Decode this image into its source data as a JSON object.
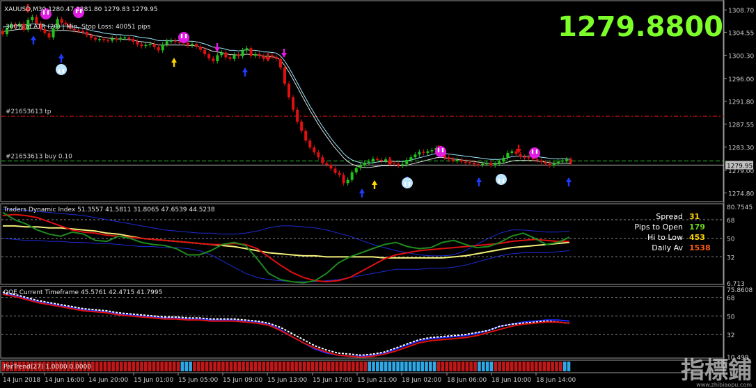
{
  "main": {
    "symbol_line": "XAUUSD,M30  1280.47 1281.80 1279.83 1279.95",
    "info_line": "300% of ATR (20) | Min. Stop Loss:  40051 pips",
    "big_price": "1279.8800",
    "tp_label": "#21653613 tp",
    "buy_label": "#21653613 buy 0.10",
    "current_price_label": "1279.95",
    "price_ticks": [
      "1308.70",
      "1304.55",
      "1300.30",
      "1296.00",
      "1291.80",
      "1287.55",
      "1283.30",
      "1279.00",
      "1274.80"
    ],
    "price_range": [
      1273.3,
      1310.4
    ]
  },
  "tdi": {
    "label": "Traders Dynamic Index 51.3557 41.5811 31.8065 47.6539 44.5238",
    "ticks": [
      "80.7545",
      "68",
      "50",
      "32",
      "6.713"
    ],
    "stats": [
      {
        "label": "Spread",
        "value": "31",
        "color": "#ffd400"
      },
      {
        "label": "Pips to Open",
        "value": "179",
        "color": "#6cd81c"
      },
      {
        "label": "Hi to Low",
        "value": "453",
        "color": "#ffd400"
      },
      {
        "label": "Daily Av",
        "value": "1538",
        "color": "#ff5b1a"
      }
    ]
  },
  "qqe": {
    "label": "QQE Current Timeframe 45.5761 42.4715 41.7995",
    "ticks": [
      "75.8608",
      "68",
      "50",
      "32",
      "10.499"
    ]
  },
  "strip": {
    "label": "ParTrend(27) 1.0000 0.0000"
  },
  "time_labels": [
    "14 Jun 2018",
    "14 Jun 16:00",
    "14 Jun 20:00",
    "15 Jun 01:00",
    "15 Jun 05:00",
    "15 Jun 09:00",
    "15 Jun 13:00",
    "15 Jun 17:00",
    "15 Jun 21:00",
    "18 Jun 02:00",
    "18 Jun 06:00",
    "18 Jun 10:00",
    "18 Jun 14:00"
  ],
  "watermark": {
    "cn": "指標鋪",
    "url": "www.zhibiaopu.com"
  },
  "colors": {
    "bull": "#22c31a",
    "bear": "#e01010",
    "accent": "#7dff2a",
    "up_arrow": "#1f3bff",
    "magenta": "#e11de1",
    "cyan": "#bfe6ff",
    "yellow": "#f4f07a"
  },
  "chart_data": [
    {
      "type": "candlestick",
      "title": "XAUUSD,M30",
      "ylim": [
        1273.3,
        1310.4
      ],
      "close": [
        1304.2,
        1305.4,
        1306.0,
        1305.6,
        1306.1,
        1305.0,
        1306.8,
        1307.4,
        1306.2,
        1305.1,
        1304.4,
        1303.6,
        1305.2,
        1307.0,
        1306.3,
        1306.0,
        1305.2,
        1304.9,
        1304.8,
        1304.6,
        1304.0,
        1303.5,
        1303.2,
        1303.3,
        1303.1,
        1303.0,
        1303.4,
        1303.2,
        1303.5,
        1303.6,
        1303.3,
        1302.8,
        1302.3,
        1302.0,
        1302.2,
        1302.4,
        1301.8,
        1301.2,
        1302.3,
        1302.9,
        1303.0,
        1302.8,
        1302.7,
        1302.6,
        1302.1,
        1302.4,
        1301.9,
        1301.3,
        1300.5,
        1299.7,
        1299.2,
        1300.3,
        1300.8,
        1299.9,
        1299.6,
        1300.4,
        1300.1,
        1301.2,
        1301.6,
        1300.2,
        1300.5,
        1300.1,
        1299.6,
        1300.3,
        1300.0,
        1299.6,
        1298.0,
        1295.0,
        1292.5,
        1290.2,
        1288.0,
        1286.3,
        1284.5,
        1283.2,
        1282.3,
        1281.4,
        1280.3,
        1280.0,
        1279.3,
        1278.5,
        1278.1,
        1276.6,
        1277.2,
        1278.6,
        1279.4,
        1279.9,
        1280.4,
        1280.6,
        1281.1,
        1280.9,
        1280.7,
        1281.0,
        1280.4,
        1280.2,
        1279.8,
        1280.1,
        1280.9,
        1281.4,
        1281.9,
        1282.4,
        1282.2,
        1282.5,
        1282.7,
        1283.1,
        1282.4,
        1281.4,
        1281.0,
        1280.7,
        1280.9,
        1280.6,
        1280.5,
        1280.4,
        1280.1,
        1280.0,
        1280.2,
        1280.3,
        1279.9,
        1280.2,
        1280.6,
        1281.3,
        1282.2,
        1282.5,
        1282.0,
        1281.5,
        1281.4,
        1281.2,
        1281.0,
        1280.8,
        1280.5,
        1280.2,
        1279.9,
        1280.3,
        1280.6,
        1280.8,
        1281.0,
        1280.3
      ],
      "open_shift": 0.6,
      "moving_average": [
        1305.2,
        1305.3,
        1305.4,
        1305.5,
        1305.6,
        1305.6,
        1305.7,
        1305.8,
        1305.8,
        1305.7,
        1305.5,
        1305.3,
        1305.3,
        1305.4,
        1305.4,
        1305.4,
        1305.3,
        1305.2,
        1305.1,
        1305.0,
        1304.8,
        1304.6,
        1304.4,
        1304.3,
        1304.1,
        1304.0,
        1303.9,
        1303.8,
        1303.8,
        1303.7,
        1303.7,
        1303.6,
        1303.4,
        1303.3,
        1303.2,
        1303.1,
        1302.9,
        1302.7,
        1302.7,
        1302.7,
        1302.7,
        1302.7,
        1302.7,
        1302.7,
        1302.6,
        1302.6,
        1302.5,
        1302.3,
        1302.1,
        1301.8,
        1301.5,
        1301.4,
        1301.3,
        1301.1,
        1300.9,
        1300.9,
        1300.8,
        1300.9,
        1301.0,
        1300.9,
        1300.9,
        1300.8,
        1300.6,
        1300.6,
        1300.5,
        1300.4,
        1299.9,
        1298.9,
        1297.7,
        1296.3,
        1294.9,
        1293.4,
        1292.0,
        1290.6,
        1289.3,
        1288.0,
        1286.8,
        1285.7,
        1284.6,
        1283.6,
        1282.7,
        1281.8,
        1281.1,
        1280.6,
        1280.3,
        1280.1,
        1280.0,
        1280.0,
        1280.1,
        1280.2,
        1280.3,
        1280.3,
        1280.3,
        1280.3,
        1280.3,
        1280.3,
        1280.4,
        1280.6,
        1280.8,
        1281.0,
        1281.2,
        1281.4,
        1281.6,
        1281.8,
        1281.9,
        1281.8,
        1281.7,
        1281.6,
        1281.5,
        1281.4,
        1281.3,
        1281.2,
        1281.1,
        1281.0,
        1280.9,
        1280.8,
        1280.7,
        1280.7,
        1280.7,
        1280.8,
        1281.0,
        1281.2,
        1281.3,
        1281.3,
        1281.3,
        1281.3,
        1281.3,
        1281.2,
        1281.1,
        1281.0,
        1280.9,
        1280.8,
        1280.8,
        1280.8,
        1280.8,
        1280.7
      ],
      "tp_level": 1289.0,
      "buy_level": 1280.7,
      "current_level": 1279.95
    },
    {
      "type": "line",
      "title": "Traders Dynamic Index",
      "ylim": [
        6.713,
        80.7545
      ],
      "levels": [
        68,
        50,
        32
      ],
      "series": [
        {
          "color": "#1f2bd6",
          "values": [
            78,
            78,
            77,
            76,
            75,
            74,
            73,
            72,
            70,
            68,
            66,
            64,
            62,
            60,
            58,
            57,
            56,
            55,
            55,
            54,
            54,
            55,
            57,
            60,
            62,
            62,
            61,
            60,
            58,
            55,
            52,
            48,
            44,
            41,
            38,
            36,
            34,
            33,
            33,
            34,
            38,
            44,
            50,
            55,
            58,
            58,
            57,
            56,
            56,
            57
          ]
        },
        {
          "color": "#1f2bd6",
          "values": [
            50,
            49,
            48,
            48,
            47,
            47,
            46,
            46,
            45,
            45,
            44,
            43,
            42,
            42,
            41,
            41,
            40,
            38,
            34,
            28,
            22,
            16,
            12,
            10,
            9,
            8,
            8,
            8,
            9,
            10,
            12,
            14,
            16,
            18,
            20,
            20,
            20,
            21,
            21,
            22,
            24,
            27,
            30,
            33,
            35,
            36,
            36,
            36,
            37,
            38
          ]
        },
        {
          "color": "#f4f07a",
          "values": [
            62,
            62,
            61,
            61,
            60,
            60,
            59,
            58,
            57,
            55,
            54,
            52,
            50,
            49,
            48,
            47,
            46,
            45,
            44,
            43,
            42,
            40,
            38,
            36,
            35,
            34,
            33,
            33,
            32,
            32,
            32,
            32,
            32,
            31,
            31,
            31,
            31,
            31,
            31,
            32,
            33,
            35,
            37,
            39,
            41,
            42,
            43,
            44,
            45,
            46
          ]
        },
        {
          "color": "#e01010",
          "values": [
            72,
            73,
            72,
            70,
            66,
            62,
            58,
            56,
            55,
            53,
            52,
            51,
            50,
            49,
            48,
            47,
            46,
            45,
            44,
            44,
            45,
            44,
            40,
            32,
            24,
            17,
            12,
            9,
            8,
            9,
            12,
            18,
            24,
            30,
            34,
            36,
            38,
            39,
            40,
            41,
            42,
            43,
            44,
            45,
            47,
            48,
            49,
            48,
            47,
            47
          ]
        },
        {
          "color": "#1e8c1e",
          "values": [
            75,
            68,
            64,
            58,
            54,
            52,
            56,
            54,
            48,
            47,
            52,
            50,
            46,
            44,
            43,
            40,
            34,
            34,
            38,
            44,
            46,
            43,
            30,
            16,
            10,
            8,
            7,
            9,
            16,
            26,
            32,
            36,
            40,
            44,
            46,
            42,
            40,
            41,
            46,
            48,
            44,
            41,
            42,
            46,
            52,
            55,
            50,
            44,
            46,
            51
          ]
        }
      ]
    },
    {
      "type": "line",
      "title": "QQE Current Timeframe",
      "ylim": [
        10.499,
        75.8608
      ],
      "levels": [
        68,
        50,
        32
      ],
      "series": [
        {
          "color": "#1a2aff",
          "values": [
            72,
            70,
            67,
            64,
            62,
            60,
            58,
            56,
            55,
            54,
            52,
            51,
            50,
            49,
            48,
            48,
            47,
            47,
            46,
            46,
            46,
            45,
            44,
            42,
            37,
            30,
            24,
            18,
            14,
            12,
            11,
            11,
            12,
            14,
            18,
            22,
            26,
            28,
            29,
            30,
            31,
            33,
            36,
            40,
            42,
            44,
            45,
            46,
            46,
            45
          ]
        },
        {
          "color": "#ffffff",
          "values": [
            73,
            71,
            68,
            65,
            63,
            61,
            59,
            57,
            56,
            55,
            53,
            52,
            51,
            50,
            49,
            49,
            48,
            48,
            47,
            47,
            47,
            46,
            45,
            43,
            39,
            33,
            27,
            21,
            17,
            14,
            13,
            12,
            13,
            15,
            19,
            23,
            27,
            29,
            30,
            31,
            32,
            34,
            36,
            40,
            42,
            43,
            44,
            45,
            44,
            43
          ]
        },
        {
          "color": "#e01010",
          "values": [
            71,
            69,
            66,
            63,
            61,
            59,
            57,
            55,
            54,
            53,
            51,
            50,
            49,
            48,
            47,
            47,
            46,
            46,
            45,
            45,
            45,
            44,
            43,
            41,
            36,
            30,
            24,
            19,
            15,
            12,
            11,
            10,
            11,
            13,
            16,
            20,
            24,
            26,
            27,
            28,
            29,
            31,
            34,
            37,
            40,
            42,
            43,
            44,
            44,
            43
          ]
        }
      ]
    }
  ]
}
